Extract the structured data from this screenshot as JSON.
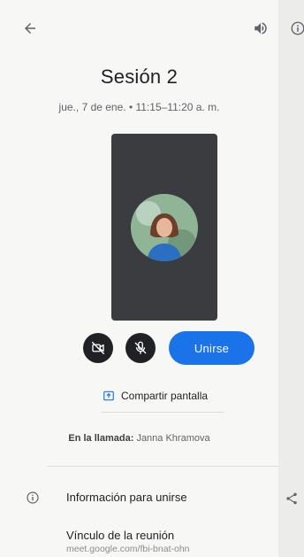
{
  "header": {
    "back_icon": "arrow-left-icon",
    "speaker_icon": "speaker-icon",
    "info_icon": "info-icon"
  },
  "meeting": {
    "title": "Sesión 2",
    "datetime": "jue., 7 de ene. • 11:15–11:20 a. m."
  },
  "controls": {
    "camera_icon": "camera-off-icon",
    "mic_icon": "mic-off-icon",
    "join_label": "Unirse",
    "join_color": "#1a73e8"
  },
  "share": {
    "icon": "present-screen-icon",
    "label": "Compartir pantalla"
  },
  "in_call": {
    "label": "En la llamada:",
    "names": "Janna Khramova"
  },
  "join_info": {
    "icon": "info-icon",
    "label": "Información para unirse",
    "share_icon": "share-icon",
    "link_label": "Vínculo de la reunión",
    "link_value": "meet.google.com/fbi-bnat-ohn"
  }
}
